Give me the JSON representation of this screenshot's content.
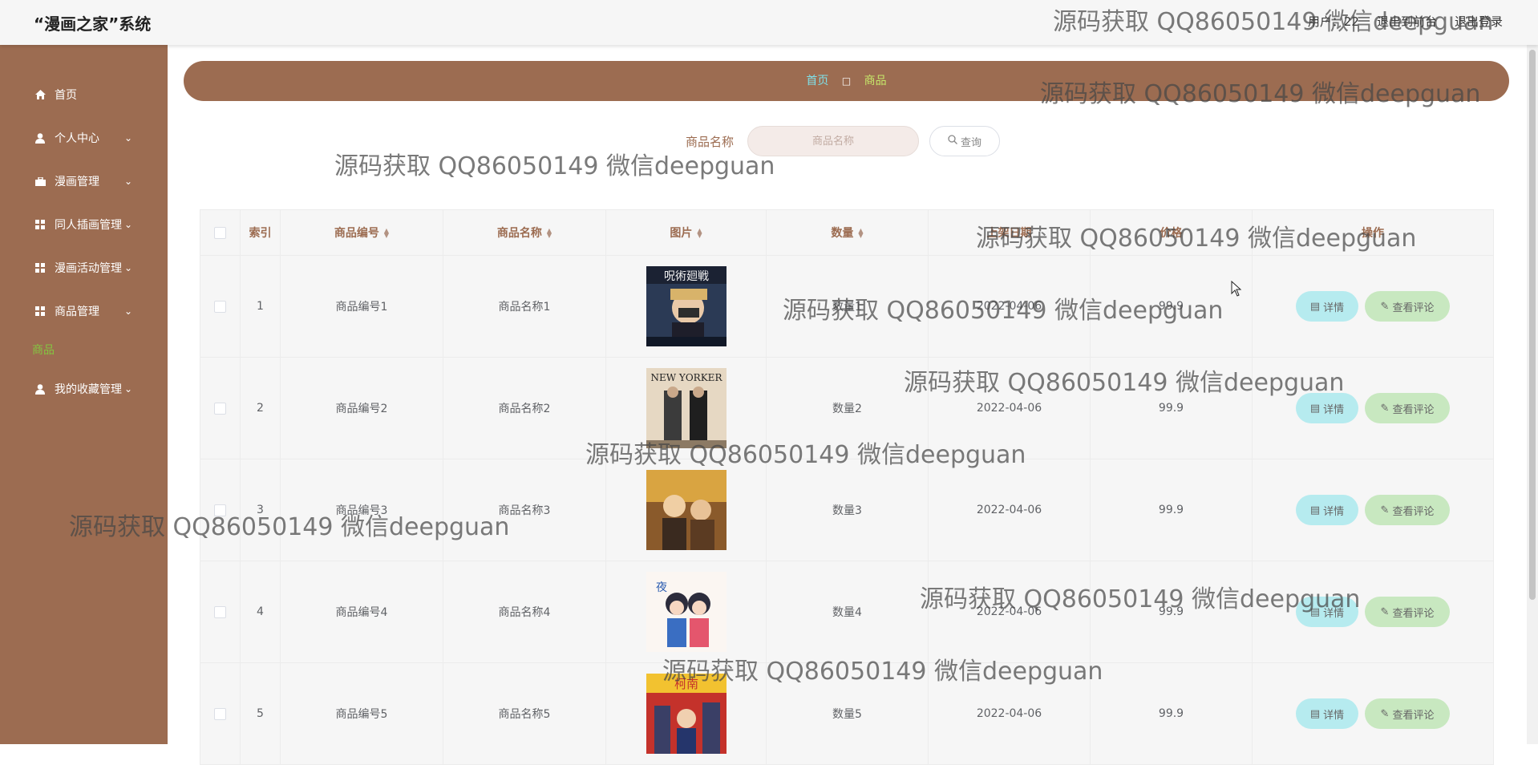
{
  "app": {
    "title": "“漫画之家”系统"
  },
  "top_links": [
    "用户：22",
    "退出到前台",
    "退出登录"
  ],
  "sidebar": {
    "items": [
      {
        "label": "首页",
        "icon": "home-icon",
        "has_children": false
      },
      {
        "label": "个人中心",
        "icon": "user-icon",
        "has_children": true
      },
      {
        "label": "漫画管理",
        "icon": "briefcase-icon",
        "has_children": true
      },
      {
        "label": "同人插画管理",
        "icon": "grid-icon",
        "has_children": true
      },
      {
        "label": "漫画活动管理",
        "icon": "grid-icon",
        "has_children": true
      },
      {
        "label": "商品管理",
        "icon": "grid-icon",
        "has_children": true
      },
      {
        "label": "我的收藏管理",
        "icon": "user-star-icon",
        "has_children": true
      }
    ],
    "active_sub": "商品"
  },
  "breadcrumb": {
    "home": "首页",
    "separator": "□",
    "current": "商品"
  },
  "search": {
    "label": "商品名称",
    "placeholder": "商品名称",
    "button": "查询"
  },
  "table": {
    "columns": [
      "索引",
      "商品编号",
      "商品名称",
      "图片",
      "数量",
      "上架日期",
      "价格",
      "操作"
    ],
    "rows": [
      {
        "index": "1",
        "code": "商品编号1",
        "name": "商品名称1",
        "qty": "数量1",
        "date": "2022-04-06",
        "price": "99.9"
      },
      {
        "index": "2",
        "code": "商品编号2",
        "name": "商品名称2",
        "qty": "数量2",
        "date": "2022-04-06",
        "price": "99.9"
      },
      {
        "index": "3",
        "code": "商品编号3",
        "name": "商品名称3",
        "qty": "数量3",
        "date": "2022-04-06",
        "price": "99.9"
      },
      {
        "index": "4",
        "code": "商品编号4",
        "name": "商品名称4",
        "qty": "数量4",
        "date": "2022-04-06",
        "price": "99.9"
      },
      {
        "index": "5",
        "code": "商品编号5",
        "name": "商品名称5",
        "qty": "数量5",
        "date": "2022-04-06",
        "price": "99.9"
      }
    ],
    "actions": {
      "detail": "详情",
      "comment": "查看评论"
    }
  },
  "watermark": "源码获取 QQ86050149 微信deepguan",
  "colors": {
    "brand": "#9c6c51",
    "active": "#84c541",
    "detail_btn": "#b6ebef",
    "comment_btn": "#c8e8c0"
  }
}
